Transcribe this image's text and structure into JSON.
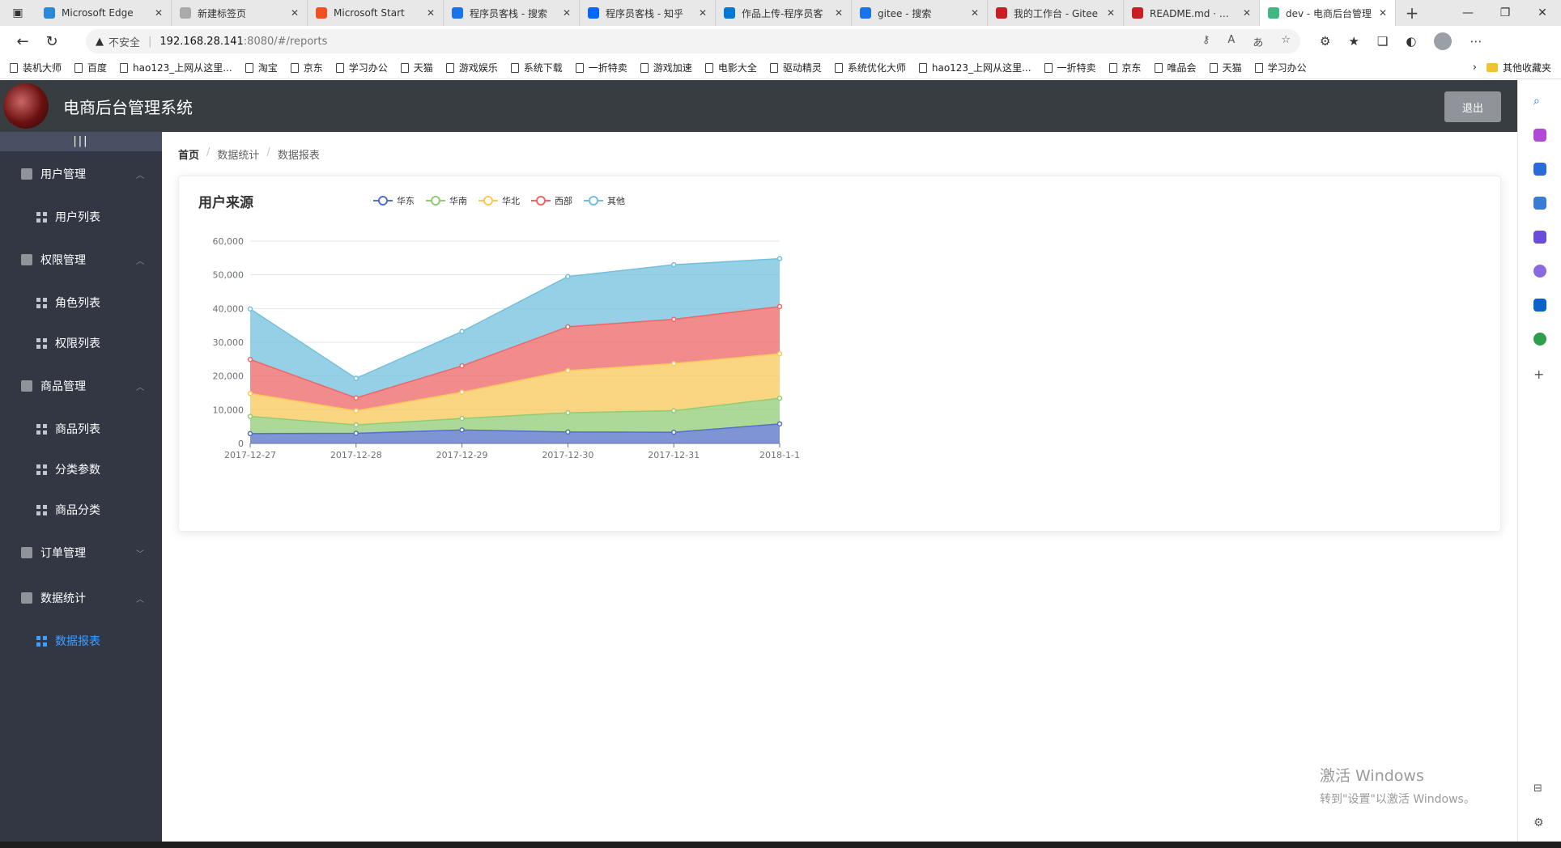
{
  "browser": {
    "tabs": [
      {
        "label": "Microsoft Edge",
        "color": "#2b88d8"
      },
      {
        "label": "新建标签页",
        "color": "#aaaaaa"
      },
      {
        "label": "Microsoft Start",
        "color": "#f25022"
      },
      {
        "label": "程序员客栈 - 搜索",
        "color": "#1a73e8"
      },
      {
        "label": "程序员客栈 - 知乎",
        "color": "#0066ff"
      },
      {
        "label": "作品上传-程序员客",
        "color": "#0078d4"
      },
      {
        "label": "gitee - 搜索",
        "color": "#1a73e8"
      },
      {
        "label": "我的工作台 - Gitee",
        "color": "#c71d23"
      },
      {
        "label": "README.md · 解字",
        "color": "#c71d23"
      },
      {
        "label": "dev - 电商后台管理",
        "color": "#41b883"
      }
    ],
    "insecure_label": "不安全",
    "url_host": "192.168.28.141",
    "url_path": ":8080/#/reports",
    "bookmarks": [
      "装机大师",
      "百度",
      "hao123_上网从这里...",
      "淘宝",
      "京东",
      "学习办公",
      "天猫",
      "游戏娱乐",
      "系统下载",
      "一折特卖",
      "游戏加速",
      "电影大全",
      "驱动精灵",
      "系统优化大师",
      "hao123_上网从这里...",
      "一折特卖",
      "京东",
      "唯品会",
      "天猫",
      "学习办公"
    ],
    "other_bookmarks": "其他收藏夹"
  },
  "header": {
    "title": "电商后台管理系统",
    "logout_label": "退出"
  },
  "sidebar": {
    "toggle_label": "|||",
    "groups": [
      {
        "label": "用户管理",
        "items": [
          "用户列表"
        ]
      },
      {
        "label": "权限管理",
        "items": [
          "角色列表",
          "权限列表"
        ]
      },
      {
        "label": "商品管理",
        "items": [
          "商品列表",
          "分类参数",
          "商品分类"
        ]
      },
      {
        "label": "订单管理",
        "items": []
      },
      {
        "label": "数据统计",
        "items": [
          "数据报表"
        ]
      }
    ],
    "active_item": "数据报表"
  },
  "breadcrumb": {
    "home": "首页",
    "level1": "数据统计",
    "level2": "数据报表"
  },
  "chart_data": {
    "type": "area",
    "stacked": true,
    "title": "用户来源",
    "categories": [
      "2017-12-27",
      "2017-12-28",
      "2017-12-29",
      "2017-12-30",
      "2017-12-31",
      "2018-1-1"
    ],
    "ylim": [
      0,
      60000
    ],
    "yticks": [
      "0",
      "10,000",
      "20,000",
      "30,000",
      "40,000",
      "50,000",
      "60,000"
    ],
    "legend_position": "top",
    "grid": true,
    "series": [
      {
        "name": "华东",
        "color": "#5470c6",
        "values": [
          2900,
          3000,
          4000,
          3400,
          3300,
          5800
        ]
      },
      {
        "name": "华南",
        "color": "#91cc75",
        "values": [
          5100,
          2500,
          3400,
          5700,
          6400,
          7600
        ]
      },
      {
        "name": "华北",
        "color": "#fac858",
        "values": [
          6800,
          4200,
          7800,
          12500,
          14000,
          13200
        ]
      },
      {
        "name": "西部",
        "color": "#ee6666",
        "values": [
          10100,
          3800,
          7800,
          13000,
          13100,
          14000
        ]
      },
      {
        "name": "其他",
        "color": "#73c0de",
        "values": [
          15000,
          5800,
          10200,
          14900,
          16200,
          14200
        ]
      }
    ]
  },
  "watermark": {
    "line1": "激活 Windows",
    "line2": "转到\"设置\"以激活 Windows。"
  }
}
